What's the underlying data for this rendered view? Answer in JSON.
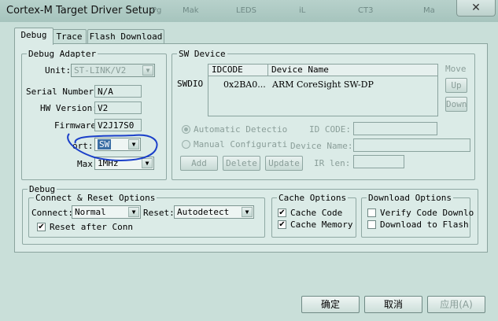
{
  "window": {
    "title": "Cortex-M Target Driver Setup",
    "close_label": "✕",
    "background_texts": [
      "Pg",
      "Mak",
      "LEDS",
      "iL",
      "CT3",
      "Ma"
    ]
  },
  "tabs": [
    {
      "label": "Debug",
      "active": true
    },
    {
      "label": "Trace",
      "active": false
    },
    {
      "label": "Flash Download",
      "active": false
    }
  ],
  "debug_adapter": {
    "legend": "Debug Adapter",
    "unit_label": "Unit:",
    "unit_value": "ST-LINK/V2",
    "serial_label": "Serial Number:",
    "serial_value": "N/A",
    "hw_label": "HW Version:",
    "hw_value": "V2",
    "fw_label": "Firmware",
    "fw_value": "V2J17S0",
    "port_label": "ort:",
    "port_value": "SW",
    "max_label": "Max",
    "max_value": "1MHz"
  },
  "sw_device": {
    "legend": "SW Device",
    "swdio_label": "SWDIO",
    "col_idcode": "IDCODE",
    "col_device": "Device Name",
    "row_idcode": "0x2BA0...",
    "row_device": "ARM CoreSight SW-DP",
    "move_label": "Move",
    "up_label": "Up",
    "down_label": "Down",
    "auto_label": "Automatic Detectio",
    "manual_label": "Manual Configurati",
    "id_code_label": "ID CODE:",
    "device_name_label": "Device Name:",
    "ir_len_label": "IR len:",
    "add_label": "Add",
    "delete_label": "Delete",
    "update_label": "Update"
  },
  "debug": {
    "legend": "Debug",
    "connect_reset": {
      "legend": "Connect & Reset Options",
      "connect_label": "Connect:",
      "connect_value": "Normal",
      "reset_label": "Reset:",
      "reset_value": "Autodetect",
      "reset_after_label": "Reset after Conn",
      "reset_after_checked": true
    },
    "cache": {
      "legend": "Cache Options",
      "code_label": "Cache Code",
      "code_checked": true,
      "memory_label": "Cache Memory",
      "memory_checked": true
    },
    "download": {
      "legend": "Download Options",
      "verify_label": "Verify Code Downlo",
      "verify_checked": false,
      "flash_label": "Download to Flash",
      "flash_checked": false
    }
  },
  "buttons": {
    "ok": "确定",
    "cancel": "取消",
    "apply": "应用(A)"
  },
  "colors": {
    "dialog_bg": "#c9dfd9",
    "panel_bg": "#dbebe7",
    "annotation_ink": "#1a3fc9",
    "port_highlight": "#3a6ea5"
  }
}
